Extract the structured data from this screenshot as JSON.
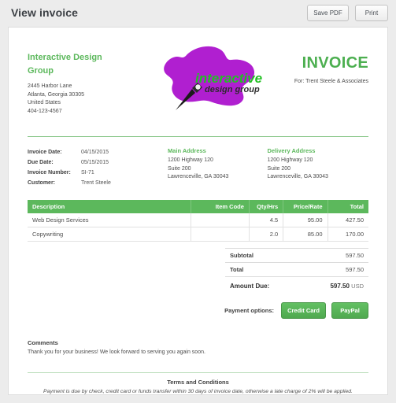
{
  "topbar": {
    "title": "View invoice",
    "save_pdf_label": "Save PDF",
    "print_label": "Print"
  },
  "company": {
    "name": "Interactive Design Group",
    "street": "2445 Harbor Lane",
    "city": "Atlanta, Georgia 30305",
    "country": "United States",
    "phone": "404-123-4567"
  },
  "logo": {
    "word_top": "interactive",
    "word_bottom": "design group",
    "splat_color": "#b01fd0",
    "word_top_color": "#22c023",
    "word_bottom_color": "#2b2b2b"
  },
  "invoice_header": {
    "heading": "INVOICE",
    "for_line": "For: Trent Steele & Associates"
  },
  "meta": {
    "rows": [
      {
        "label": "Invoice Date:",
        "value": "04/15/2015"
      },
      {
        "label": "Due Date:",
        "value": "05/15/2015"
      },
      {
        "label": "Invoice Number:",
        "value": "SI-71"
      },
      {
        "label": "Customer:",
        "value": "Trent Steele"
      }
    ],
    "main_address": {
      "title": "Main Address",
      "line1": "1200 Highway 120",
      "line2": "Suite 200",
      "line3": "Lawrenceville, GA 30043"
    },
    "delivery_address": {
      "title": "Delivery Address",
      "line1": "1200 Highway 120",
      "line2": "Suite 200",
      "line3": "Lawrenceville, GA 30043"
    }
  },
  "items_table": {
    "headers": {
      "description": "Description",
      "item_code": "Item Code",
      "qty": "Qty/Hrs",
      "rate": "Price/Rate",
      "total": "Total"
    },
    "rows": [
      {
        "description": "Web Design Services",
        "item_code": "",
        "qty": "4.5",
        "rate": "95.00",
        "total": "427.50"
      },
      {
        "description": "Copywriting",
        "item_code": "",
        "qty": "2.0",
        "rate": "85.00",
        "total": "170.00"
      }
    ]
  },
  "totals": {
    "subtotal_label": "Subtotal",
    "subtotal_value": "597.50",
    "total_label": "Total",
    "total_value": "597.50",
    "amount_due_label": "Amount Due:",
    "amount_due_value": "597.50",
    "currency": "USD"
  },
  "payment": {
    "label": "Payment options:",
    "credit_card_label": "Credit Card",
    "paypal_label": "PayPal"
  },
  "comments": {
    "title": "Comments",
    "body": "Thank you for your business! We look forward to serving you again soon."
  },
  "terms": {
    "title": "Terms and Conditions",
    "body": "Payment is due by check, credit card or funds transfer within 30 days of invoice date, otherwise a late charge of 2% will be applied."
  },
  "theme": {
    "accent_green": "#5cb85c",
    "page_bg": "#ececec"
  }
}
